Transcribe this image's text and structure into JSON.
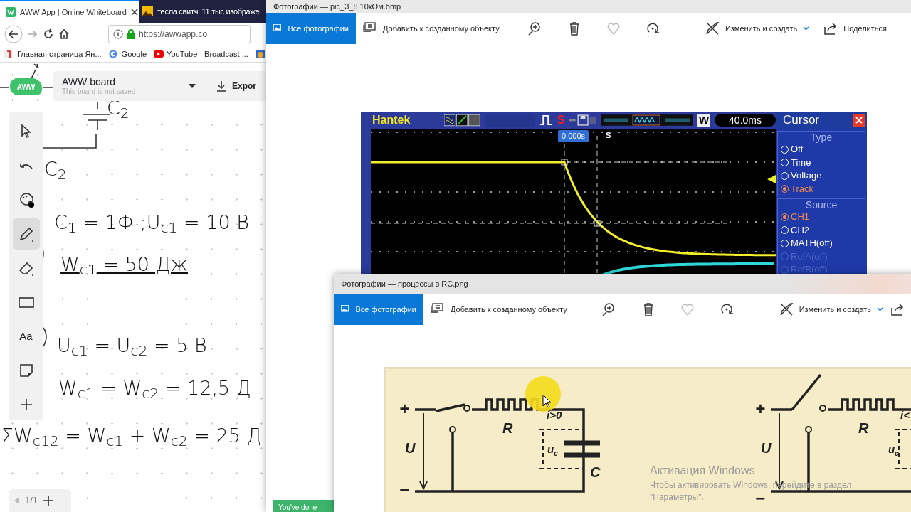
{
  "browser": {
    "tabs": [
      {
        "title": "AWW App | Online Whiteboard",
        "selected": true
      },
      {
        "title": "тесла свитч: 11 тыс изображе",
        "selected": false
      }
    ],
    "address": "https://awwapp.co",
    "bookmarks": [
      {
        "kind": "yandex",
        "label": "Главная страница Ян..."
      },
      {
        "kind": "google",
        "label": "Google"
      },
      {
        "kind": "youtube",
        "label": "YouTube - Broadcast ..."
      },
      {
        "kind": "app"
      }
    ]
  },
  "board": {
    "logo": "AWW",
    "title": "AWW board",
    "subtitle": "This board is not saved",
    "export": "Expor",
    "tools": [
      {
        "kind": "pointer",
        "selected": false
      },
      {
        "kind": "undo",
        "selected": false
      },
      {
        "kind": "palette",
        "selected": false
      },
      {
        "kind": "pencil",
        "selected": true
      },
      {
        "kind": "eraser",
        "selected": false
      },
      {
        "kind": "rectangle",
        "selected": false
      },
      {
        "kind": "text",
        "label": "Aa",
        "selected": false
      },
      {
        "kind": "sticky",
        "selected": false
      },
      {
        "kind": "add",
        "selected": false
      }
    ],
    "notes": [
      {
        "text": "C$_{2}$",
        "underlined": false
      },
      {
        "text": "C$_{2}$",
        "underlined": false
      },
      {
        "text": "C$_{1}$ = 1Ф ;U$_{c1}$ = 10 В",
        "underlined": false
      },
      {
        "text": "W$_{c1}$ = 50 Дж",
        "underlined": true
      },
      {
        "text": "U$_{c1}$ = U$_{c2}$ = 5 В",
        "underlined": false
      },
      {
        "text": "W$_{c1}$ = W$_{c2}$ = 12,5 Д",
        "underlined": false
      },
      {
        "text": "ΣW$_{c12}$ = W$_{c1}$ + W$_{c2}$ = 25 Д",
        "underlined": false
      }
    ],
    "page": "1/1"
  },
  "photo_windows": [
    {
      "title": "Фотографии — pic_3_8 10кОм.bmp",
      "toolbar": [
        {
          "kind": "all",
          "label": "Все фотографии"
        },
        {
          "kind": "add",
          "label": "Добавить к созданному объекту"
        },
        {
          "kind": "zoom"
        },
        {
          "kind": "delete"
        },
        {
          "kind": "favorite"
        },
        {
          "kind": "rotate"
        },
        {
          "kind": "edit",
          "label": "Изменить и создать"
        },
        {
          "kind": "share",
          "label": "Поделиться"
        }
      ],
      "content": {
        "kind": "scope",
        "brand": "Hantek",
        "trigger_mark": "S",
        "wave_mode": "W",
        "timebase": "40.0ms",
        "trigger_time": "0,000s",
        "marker": "S",
        "panel_title": "Cursor",
        "groups": [
          {
            "title": "Type",
            "options": [
              {
                "label": "Off",
                "selected": false,
                "disabled": false
              },
              {
                "label": "Time",
                "selected": false,
                "disabled": false
              },
              {
                "label": "Voltage",
                "selected": false,
                "disabled": false
              },
              {
                "label": "Track",
                "selected": true,
                "disabled": false
              }
            ]
          },
          {
            "title": "Source",
            "options": [
              {
                "label": "CH1",
                "selected": true,
                "disabled": false
              },
              {
                "label": "CH2",
                "selected": false,
                "disabled": false
              },
              {
                "label": "MATH(off)",
                "selected": false,
                "disabled": false
              },
              {
                "label": "RefA(off)",
                "selected": false,
                "disabled": true
              },
              {
                "label": "RefB(off)",
                "selected": false,
                "disabled": true
              }
            ]
          }
        ]
      }
    },
    {
      "title": "Фотографии — процессы в RC.png",
      "toolbar": [
        {
          "kind": "all",
          "label": "Все фотографии"
        },
        {
          "kind": "add",
          "label": "Добавить к созданному объекту"
        },
        {
          "kind": "zoom"
        },
        {
          "kind": "delete"
        },
        {
          "kind": "favorite"
        },
        {
          "kind": "rotate"
        },
        {
          "kind": "edit",
          "label": "Изменить и создать"
        },
        {
          "kind": "share"
        }
      ],
      "content": {
        "kind": "circuit",
        "diagrams": [
          {
            "plus": "+",
            "minus": "−",
            "r": "R",
            "u": "U",
            "c": "C",
            "current": "i>0",
            "uc": "u$_{c}$",
            "switch_closed": true
          },
          {
            "plus": "+",
            "minus": "−",
            "r": "R",
            "u": "U",
            "current": "i<",
            "uc": "u$_{c}$",
            "switch_closed": false
          }
        ]
      }
    }
  ],
  "toast": "You've done",
  "activation": {
    "title": "Активация Windows",
    "lines": [
      "Чтобы активировать Windows, перейдите в раздел",
      "\"Параметры\"."
    ]
  }
}
